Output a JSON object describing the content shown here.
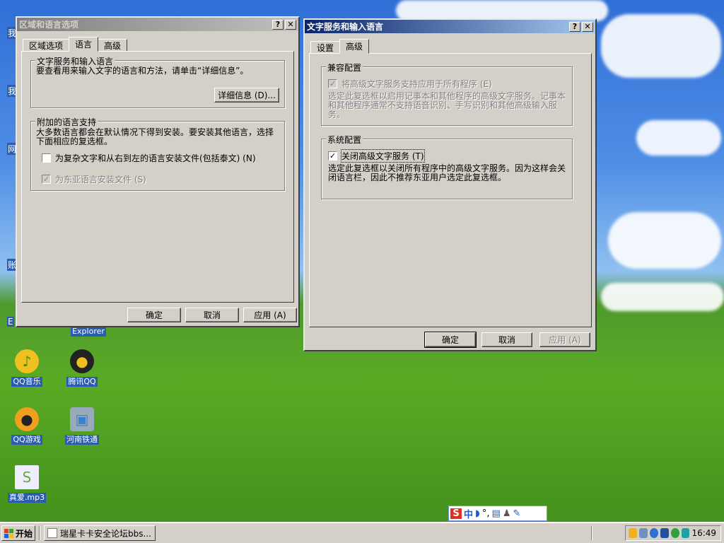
{
  "desktop": {
    "icons": [
      {
        "label": "QQ音乐",
        "icon": "qq-music-icon",
        "color": "#f0c020"
      },
      {
        "label": "腾讯QQ",
        "icon": "qq-penguin-icon",
        "color": "#222222"
      },
      {
        "label": "QQ游戏",
        "icon": "qq-game-icon",
        "color": "#f0a020"
      },
      {
        "label": "河南铁通",
        "icon": "network-computer-icon",
        "color": "#3a7fd0"
      },
      {
        "label": "真爱.mp3",
        "icon": "audio-file-icon",
        "color": "#66aa33"
      }
    ],
    "partial_label": "Explorer",
    "edge_chars": [
      "我",
      "我",
      "网",
      "账",
      "E"
    ]
  },
  "regional_window": {
    "title": "区域和语言选项",
    "tabs": [
      "区域选项",
      "语言",
      "高级"
    ],
    "group1": {
      "legend": "文字服务和输入语言",
      "text": "要查看用来输入文字的语言和方法，请单击“详细信息”。",
      "details_button": "详细信息 (D)..."
    },
    "group2": {
      "legend": "附加的语言支持",
      "text": "大多数语言都会在默认情况下得到安装。要安装其他语言，选择下面相应的复选框。",
      "chk_complex": "为复杂文字和从右到左的语言安装文件(包括泰文) (N)",
      "chk_east_asian": "为东亚语言安装文件 (S)"
    },
    "buttons": {
      "ok": "确定",
      "cancel": "取消",
      "apply": "应用 (A)"
    }
  },
  "text_services_window": {
    "title": "文字服务和输入语言",
    "tabs": [
      "设置",
      "高级"
    ],
    "compat_group": {
      "legend": "兼容配置",
      "chk_label": "将高级文字服务支持应用于所有程序 (E)",
      "desc": "选定此复选框以启用记事本和其他程序的高级文字服务。记事本和其他程序通常不支持语音识别、手写识别和其他高级输入服务。"
    },
    "system_group": {
      "legend": "系统配置",
      "chk_label": "关闭高级文字服务 (T)",
      "checked": true,
      "desc": "选定此复选框以关闭所有程序中的高级文字服务。因为这样会关闭语言栏，因此不推荐东亚用户选定此复选框。"
    },
    "buttons": {
      "ok": "确定",
      "cancel": "取消",
      "apply": "应用 (A)"
    }
  },
  "ime_bar": {
    "lang": "中",
    "punct": "°,"
  },
  "taskbar": {
    "start": "开始",
    "task": "瑞星卡卡安全论坛bbs...",
    "clock": "16:49"
  },
  "colors": {
    "title_active": "#0a246a",
    "face": "#d4d0c8",
    "desktop_label_bg": "#2a5db0"
  }
}
